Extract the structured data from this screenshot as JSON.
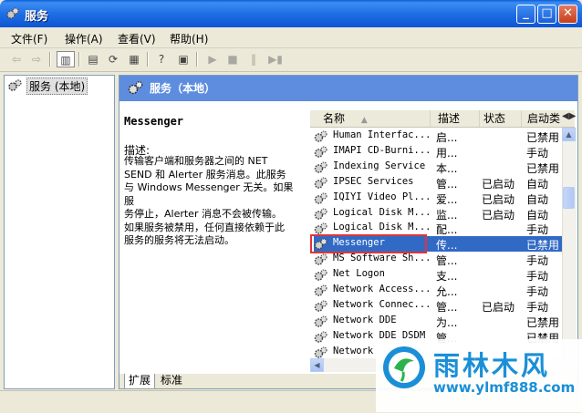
{
  "window": {
    "title": "服务"
  },
  "menu": [
    "文件(F)",
    "操作(A)",
    "查看(V)",
    "帮助(H)"
  ],
  "tree": {
    "root": "服务 (本地)"
  },
  "header": {
    "title": "服务（本地）"
  },
  "details": {
    "name": "Messenger",
    "desc_label": "描述:",
    "desc_text": "传输客户端和服务器之间的 NET\nSEND 和 Alerter 服务消息。此服务\n与 Windows Messenger 无关。如果服\n务停止，Alerter 消息不会被传输。\n如果服务被禁用，任何直接依赖于此\n服务的服务将无法启动。"
  },
  "columns": {
    "name": "名称",
    "desc": "描述",
    "status": "状态",
    "startup": "启动类"
  },
  "services": [
    {
      "name": "Human Interfac...",
      "desc": "启...",
      "status": "",
      "startup": "已禁用"
    },
    {
      "name": "IMAPI CD-Burni...",
      "desc": "用...",
      "status": "",
      "startup": "手动"
    },
    {
      "name": "Indexing Service",
      "desc": "本...",
      "status": "",
      "startup": "已禁用"
    },
    {
      "name": "IPSEC Services",
      "desc": "管...",
      "status": "已启动",
      "startup": "自动"
    },
    {
      "name": "IQIYI Video Pl...",
      "desc": "爱...",
      "status": "已启动",
      "startup": "自动"
    },
    {
      "name": "Logical Disk M...",
      "desc": "监...",
      "status": "已启动",
      "startup": "自动"
    },
    {
      "name": "Logical Disk M...",
      "desc": "配...",
      "status": "",
      "startup": "手动"
    },
    {
      "name": "Messenger",
      "desc": "传...",
      "status": "",
      "startup": "已禁用"
    },
    {
      "name": "MS Software Sh...",
      "desc": "管...",
      "status": "",
      "startup": "手动"
    },
    {
      "name": "Net Logon",
      "desc": "支...",
      "status": "",
      "startup": "手动"
    },
    {
      "name": "Network Access...",
      "desc": "允...",
      "status": "",
      "startup": "手动"
    },
    {
      "name": "Network Connec...",
      "desc": "管...",
      "status": "已启动",
      "startup": "手动"
    },
    {
      "name": "Network DDE",
      "desc": "为...",
      "status": "",
      "startup": "已禁用"
    },
    {
      "name": "Network DDE DSDM",
      "desc": "管...",
      "status": "",
      "startup": "已禁用"
    },
    {
      "name": "Network",
      "desc": "",
      "status": "",
      "startup": ""
    }
  ],
  "selected_index": 7,
  "tabs": [
    "扩展",
    "标准"
  ],
  "watermark": {
    "brand": "雨林木风",
    "url": "www.ylmf888.com"
  },
  "colors": {
    "titlebar": "#0c55d2",
    "selection": "#316ac5",
    "highlight_box": "#e0343a",
    "watermark": "#1a8fd8"
  }
}
